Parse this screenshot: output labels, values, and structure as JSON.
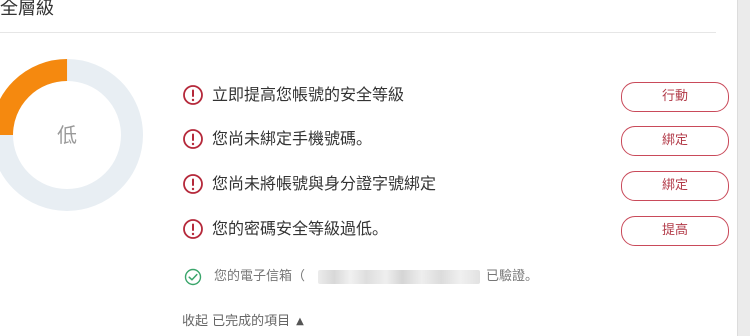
{
  "card": {
    "title": "安全層級"
  },
  "security_level": {
    "label": "低",
    "progress_fraction": 0.25,
    "colors": {
      "progress": "#f5890f",
      "track": "#e8eef3"
    }
  },
  "alerts": [
    {
      "text": "立即提高您帳號的安全等級",
      "button_label": "行動",
      "icon": "alert-circle-icon"
    },
    {
      "text": "您尚未綁定手機號碼。",
      "button_label": "綁定",
      "icon": "alert-circle-icon"
    },
    {
      "text": "您尚未將帳號與身分證字號綁定",
      "button_label": "綁定",
      "icon": "alert-circle-icon"
    },
    {
      "text": "您的密碼安全等級過低。",
      "button_label": "提高",
      "icon": "alert-circle-icon"
    }
  ],
  "email": {
    "prefix": "您的電子信箱（",
    "suffix": "已驗證。",
    "icon": "check-circle-icon"
  },
  "collapse": {
    "label": "收起 已完成的項目",
    "icon": "caret-up-icon"
  },
  "colors": {
    "alert": "#b5283a",
    "button_border": "#c94a5a",
    "success": "#3aa56b"
  }
}
